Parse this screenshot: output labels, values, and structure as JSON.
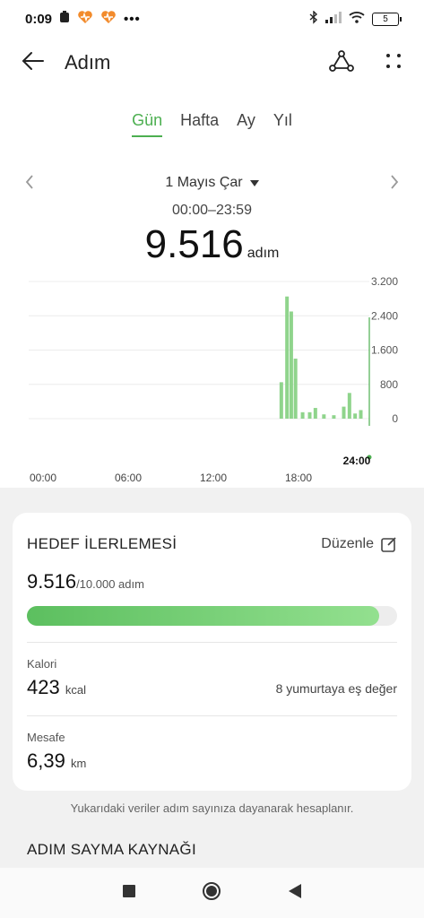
{
  "status": {
    "time": "0:09",
    "battery": "5",
    "more": "•••"
  },
  "header": {
    "title": "Adım"
  },
  "tabs": [
    {
      "label": "Gün",
      "active": true
    },
    {
      "label": "Hafta",
      "active": false
    },
    {
      "label": "Ay",
      "active": false
    },
    {
      "label": "Yıl",
      "active": false
    }
  ],
  "date": {
    "label": "1 Mayıs Çar",
    "range": "00:00–23:59"
  },
  "summary": {
    "value": "9.516",
    "unit": "adım"
  },
  "chart_data": {
    "type": "bar",
    "x_ticks": [
      "00:00",
      "06:00",
      "12:00",
      "18:00",
      "24:00"
    ],
    "y_ticks": [
      "3.200",
      "2.400",
      "1.600",
      "800",
      "0"
    ],
    "ylim": [
      0,
      3200
    ],
    "xlim": [
      0,
      24
    ],
    "grid": true,
    "color": "#8fd48c",
    "x": [
      17.8,
      18.2,
      18.5,
      18.8,
      19.3,
      19.8,
      20.2,
      20.8,
      21.5,
      22.2,
      22.6,
      23.0,
      23.4
    ],
    "values": [
      850,
      2850,
      2500,
      1400,
      150,
      150,
      250,
      100,
      80,
      280,
      600,
      120,
      200
    ],
    "cursor_x": 24,
    "cursor_color": "#4caf50"
  },
  "goal": {
    "title": "HEDEF İLERLEMESİ",
    "edit_label": "Düzenle",
    "current": "9.516",
    "target": "/10.000 adım",
    "progress": 0.9516
  },
  "calories": {
    "label": "Kalori",
    "value": "423",
    "unit": "kcal",
    "equivalent": "8 yumurtaya eş değer"
  },
  "distance": {
    "label": "Mesafe",
    "value": "6,39",
    "unit": "km"
  },
  "footnote": "Yukarıdaki veriler adım sayınıza dayanarak hesaplanır.",
  "source_title": "ADIM SAYMA KAYNAĞI",
  "colors": {
    "accent": "#4caf50",
    "bar": "#8fd48c"
  }
}
